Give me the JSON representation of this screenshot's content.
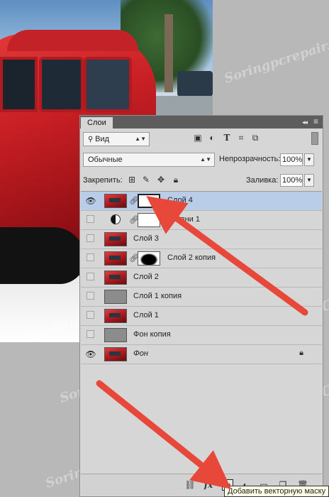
{
  "panel": {
    "tab_label": "Слои",
    "collapse_glyph": "◂◂",
    "close_glyph": "≡"
  },
  "filter": {
    "kind_label": "Вид",
    "icons": [
      "image-filter-icon",
      "adjustment-filter-icon",
      "type-filter-icon",
      "shape-filter-icon",
      "smart-object-filter-icon"
    ]
  },
  "blend": {
    "mode": "Обычные",
    "opacity_label": "Непрозрачность:",
    "opacity_value": "100%"
  },
  "lock": {
    "label": "Закрепить:",
    "fill_label": "Заливка:",
    "fill_value": "100%"
  },
  "layers": [
    {
      "name": "Слой 4",
      "visible": true,
      "selected": true,
      "thumb": "car",
      "mask": "white",
      "linked": true
    },
    {
      "name": "Уровни 1",
      "visible": false,
      "selected": false,
      "thumb": "adjustment",
      "mask": "white",
      "linked": true
    },
    {
      "name": "Слой 3",
      "visible": false,
      "selected": false,
      "thumb": "car"
    },
    {
      "name": "Слой 2 копия",
      "visible": false,
      "selected": false,
      "thumb": "car",
      "mask": "black",
      "linked": true
    },
    {
      "name": "Слой 2",
      "visible": false,
      "selected": false,
      "thumb": "car"
    },
    {
      "name": "Слой 1 копия",
      "visible": false,
      "selected": false,
      "thumb": "gray"
    },
    {
      "name": "Слой 1",
      "visible": false,
      "selected": false,
      "thumb": "car"
    },
    {
      "name": "Фон копия",
      "visible": false,
      "selected": false,
      "thumb": "gray"
    },
    {
      "name": "Фон",
      "visible": true,
      "selected": false,
      "thumb": "car",
      "italic": true,
      "locked": true
    }
  ],
  "bottom_toolbar": {
    "fx_label": "fx",
    "tooltip": "Добавить векторную маску"
  },
  "watermark": "Soringpcrepair.Com",
  "colors": {
    "panel_bg": "#d6d6d6",
    "selected_row": "#b9cde8",
    "arrow": "#e8483a"
  }
}
